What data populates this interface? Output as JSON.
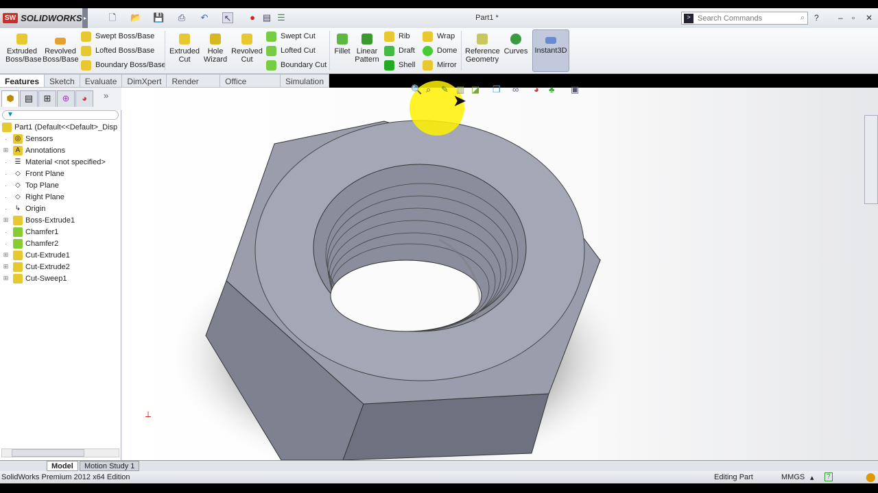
{
  "app": {
    "brand": "SOLIDWORKS",
    "doc_title": "Part1 *",
    "search_placeholder": "Search Commands"
  },
  "ribbon": {
    "big": [
      {
        "label": "Extruded\nBoss/Base",
        "color": "#e8c830"
      },
      {
        "label": "Revolved\nBoss/Base",
        "color": "#e8a030"
      },
      {
        "label": "Extruded\nCut",
        "color": "#e8c830"
      },
      {
        "label": "Hole\nWizard",
        "color": "#d8b820"
      },
      {
        "label": "Revolved\nCut",
        "color": "#e8c830"
      },
      {
        "label": "Fillet",
        "color": "#5cb840"
      },
      {
        "label": "Linear\nPattern",
        "color": "#3a9a30"
      },
      {
        "label": "Reference\nGeometry",
        "color": "#c8c860"
      },
      {
        "label": "Curves",
        "color": "#3a9a40"
      },
      {
        "label": "Instant3D",
        "color": "#6a8ad0"
      }
    ],
    "boss": [
      "Swept Boss/Base",
      "Lofted Boss/Base",
      "Boundary Boss/Base"
    ],
    "cut": [
      "Swept Cut",
      "Lofted Cut",
      "Boundary Cut"
    ],
    "col3": [
      "Rib",
      "Draft",
      "Shell"
    ],
    "col4": [
      "Wrap",
      "Dome",
      "Mirror"
    ]
  },
  "tabs": [
    "Features",
    "Sketch",
    "Evaluate",
    "DimXpert",
    "Render Tools",
    "Office Products",
    "Simulation"
  ],
  "tree": {
    "root": "Part1  (Default<<Default>_Disp",
    "items": [
      {
        "label": "Sensors",
        "expand": false,
        "icon": "sensor-icon"
      },
      {
        "label": "Annotations",
        "expand": true,
        "icon": "annotations-icon"
      },
      {
        "label": "Material <not specified>",
        "expand": false,
        "icon": "material-icon"
      },
      {
        "label": "Front Plane",
        "expand": false,
        "icon": "plane-icon"
      },
      {
        "label": "Top Plane",
        "expand": false,
        "icon": "plane-icon"
      },
      {
        "label": "Right Plane",
        "expand": false,
        "icon": "plane-icon"
      },
      {
        "label": "Origin",
        "expand": false,
        "icon": "origin-icon"
      },
      {
        "label": "Boss-Extrude1",
        "expand": true,
        "icon": "extrude-icon"
      },
      {
        "label": "Chamfer1",
        "expand": false,
        "icon": "chamfer-icon"
      },
      {
        "label": "Chamfer2",
        "expand": false,
        "icon": "chamfer-icon"
      },
      {
        "label": "Cut-Extrude1",
        "expand": true,
        "icon": "cut-extrude-icon"
      },
      {
        "label": "Cut-Extrude2",
        "expand": true,
        "icon": "cut-extrude-icon"
      },
      {
        "label": "Cut-Sweep1",
        "expand": true,
        "icon": "cut-sweep-icon"
      }
    ]
  },
  "bottom_tabs": [
    "Model",
    "Motion Study 1"
  ],
  "status": {
    "edition": "SolidWorks Premium 2012 x64 Edition",
    "mode": "Editing Part",
    "units": "MMGS"
  }
}
